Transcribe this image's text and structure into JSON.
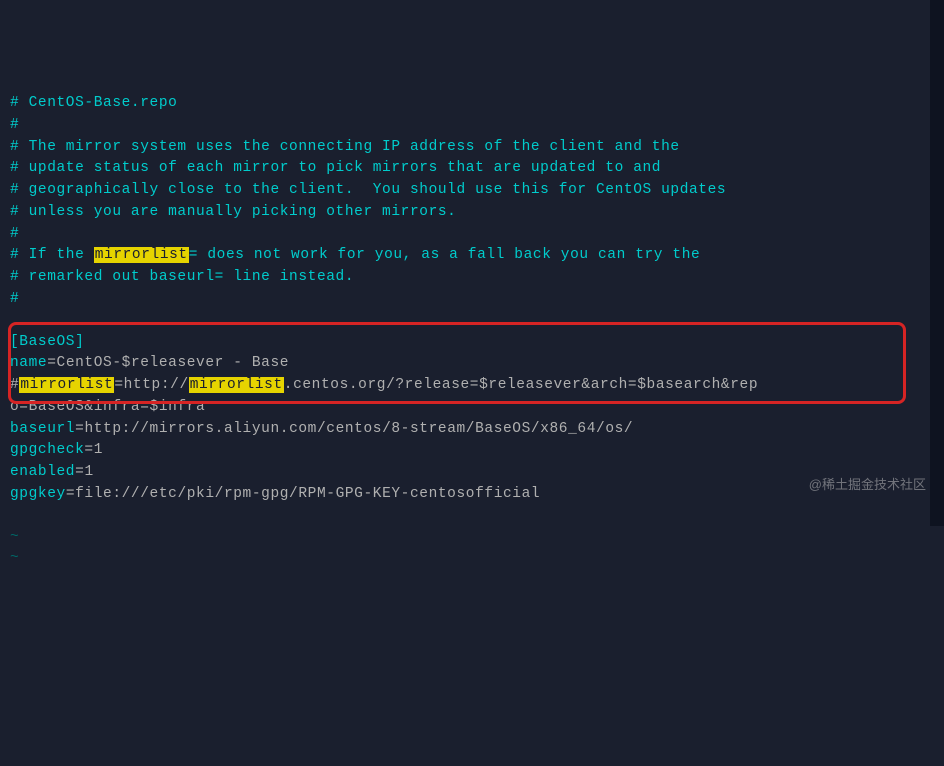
{
  "lines": {
    "c1": "# CentOS-Base.repo",
    "c2": "#",
    "c3": "# The mirror system uses the connecting IP address of the client and the",
    "c4": "# update status of each mirror to pick mirrors that are updated to and",
    "c5": "# geographically close to the client.  You should use this for CentOS updates",
    "c6": "# unless you are manually picking other mirrors.",
    "c7": "#",
    "c8a": "# If the ",
    "c8b": "mirrorlist",
    "c8c": "= does not work for you, as a fall back you can try the",
    "c9": "# remarked out baseurl= line instead.",
    "c10": "#",
    "section": "[BaseOS]",
    "name_k": "name",
    "name_v": "CentOS-$releasever - Base",
    "m_hash": "#",
    "m_hl1": "mirrorlist",
    "m_mid1": "=http://",
    "m_hl2": "mirrorlist",
    "m_mid2": ".centos.org/?release=$releasever&arch=$basearch&rep",
    "m_wrap": "o=BaseOS&infra=$infra",
    "baseurl_k": "baseurl",
    "baseurl_v": "http://mirrors.aliyun.com/centos/8-stream/BaseOS/x86_64/os/",
    "gpgcheck_k": "gpgcheck",
    "gpgcheck_v": "1",
    "enabled_k": "enabled",
    "enabled_v": "1",
    "gpgkey_k": "gpgkey",
    "gpgkey_v": "file:///etc/pki/rpm-gpg/RPM-GPG-KEY-centosofficial",
    "tilde": "~"
  },
  "watermark": "@稀土掘金技术社区"
}
